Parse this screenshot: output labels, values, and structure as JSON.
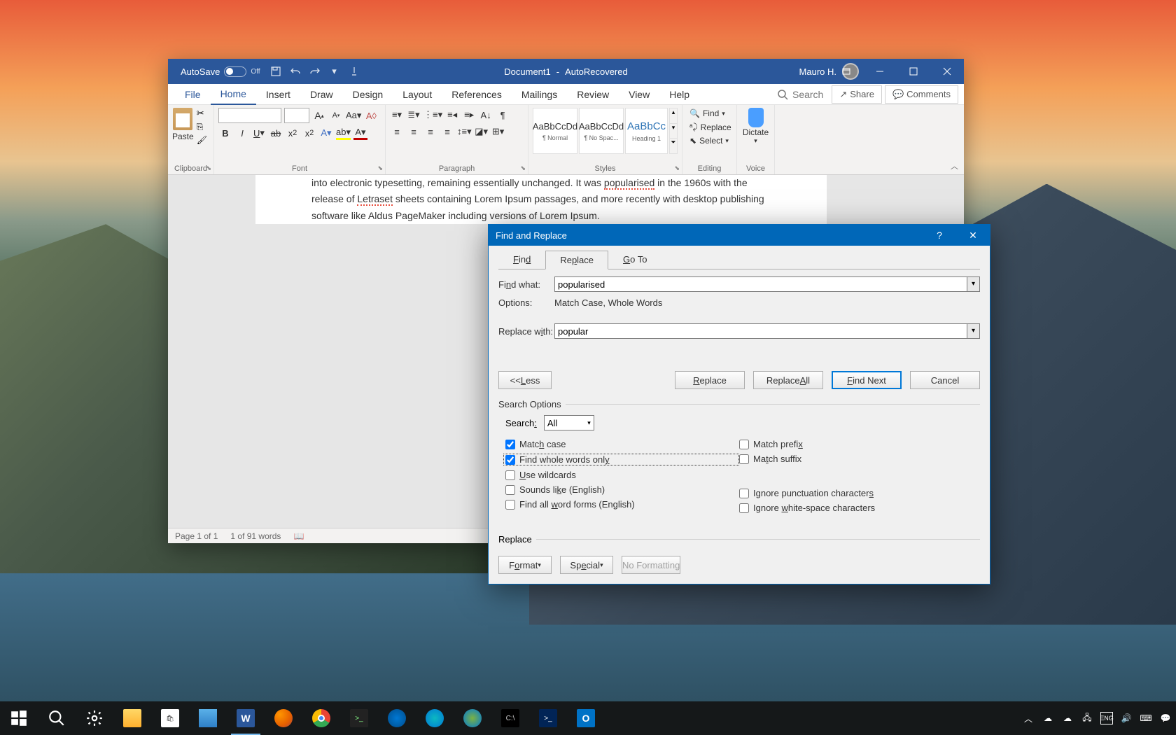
{
  "title_bar": {
    "autosave": "AutoSave",
    "autosave_state": "Off",
    "doc_name": "Document1",
    "doc_status": "AutoRecovered",
    "user_name": "Mauro H."
  },
  "ribbon_tabs": {
    "file": "File",
    "home": "Home",
    "insert": "Insert",
    "draw": "Draw",
    "design": "Design",
    "layout": "Layout",
    "references": "References",
    "mailings": "Mailings",
    "review": "Review",
    "view": "View",
    "help": "Help",
    "search": "Search",
    "share": "Share",
    "comments": "Comments"
  },
  "ribbon": {
    "clipboard_label": "Clipboard",
    "paste": "Paste",
    "font_label": "Font",
    "paragraph_label": "Paragraph",
    "styles_label": "Styles",
    "editing_label": "Editing",
    "voice_label": "Voice",
    "find": "Find",
    "replace": "Replace",
    "select": "Select",
    "dictate": "Dictate",
    "style_normal_preview": "AaBbCcDd",
    "style_normal": "¶ Normal",
    "style_nospacing_preview": "AaBbCcDd",
    "style_nospacing": "¶ No Spac...",
    "style_heading1_preview": "AaBbCc",
    "style_heading1": "Heading 1"
  },
  "document": {
    "line1a": "into electronic typesetting, remaining essentially unchanged. It was ",
    "line1b": "popularised",
    "line1c": " in the 1960s with the",
    "line2a": "release of ",
    "line2b": "Letraset",
    "line2c": " sheets containing Lorem Ipsum passages, and more recently with desktop publishing",
    "line3": "software like Aldus PageMaker including versions of Lorem Ipsum."
  },
  "status_bar": {
    "page": "Page 1 of 1",
    "words": "1 of 91 words"
  },
  "dialog": {
    "title": "Find and Replace",
    "tab_find": "Find",
    "tab_replace": "Replace",
    "tab_goto": "Go To",
    "find_what_label": "Find what:",
    "find_what_value": "popularised",
    "options_label": "Options:",
    "options_value": "Match Case, Whole Words",
    "replace_with_label": "Replace with:",
    "replace_with_value": "popular",
    "btn_less": "<< Less",
    "btn_replace": "Replace",
    "btn_replace_all": "Replace All",
    "btn_find_next": "Find Next",
    "btn_cancel": "Cancel",
    "search_options_label": "Search Options",
    "search_label": "Search:",
    "search_dropdown": "All",
    "chk_match_case": "Match case",
    "chk_whole_words": "Find whole words only",
    "chk_wildcards": "Use wildcards",
    "chk_sounds_like": "Sounds like (English)",
    "chk_word_forms": "Find all word forms (English)",
    "chk_prefix": "Match prefix",
    "chk_suffix": "Match suffix",
    "chk_punctuation": "Ignore punctuation characters",
    "chk_whitespace": "Ignore white-space characters",
    "replace_section_label": "Replace",
    "btn_format": "Format",
    "btn_special": "Special",
    "btn_no_formatting": "No Formatting"
  },
  "taskbar": {
    "time": "",
    "date": ""
  }
}
